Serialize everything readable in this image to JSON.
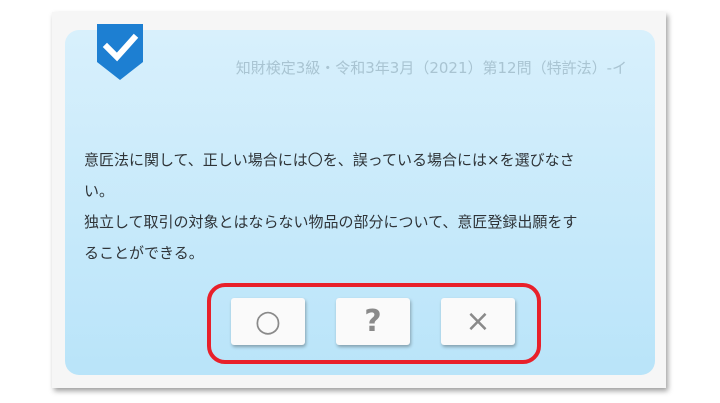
{
  "question": {
    "source": "知財検定3級・令和3年3月（2021）第12問（特許法）-イ",
    "line1": "意匠法に関して、正しい場合には〇を、誤っている場合には×を選びなさ",
    "line2": "い。",
    "line3": "独立して取引の対象とはならない物品の部分について、意匠登録出願をす",
    "line4": "ることができる。"
  },
  "answers": {
    "correct": "○",
    "unsure": "?",
    "wrong": "×"
  },
  "colors": {
    "badge": "#1d7fd2",
    "highlight": "#e8202a",
    "panel": "#c8eafb"
  },
  "icons": {
    "badge": "check-icon"
  }
}
